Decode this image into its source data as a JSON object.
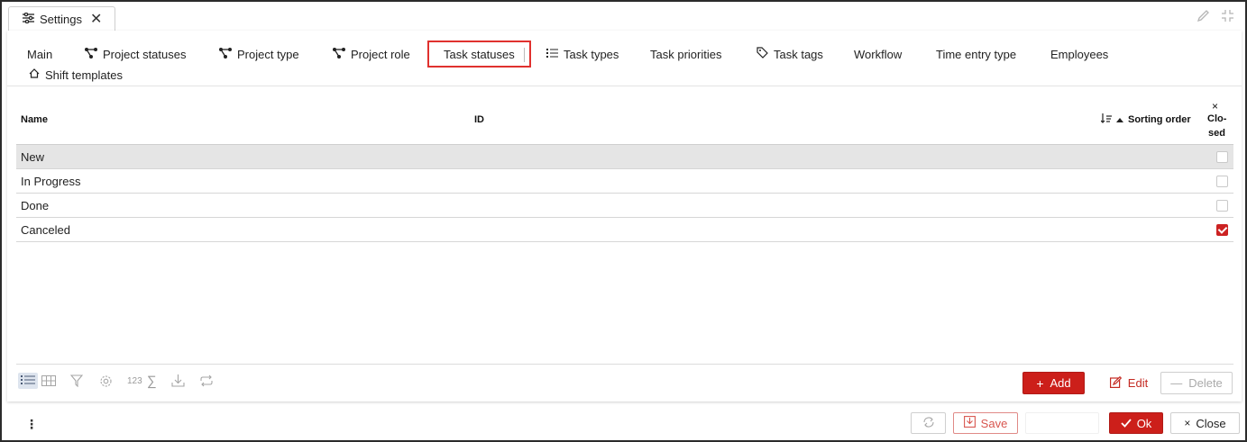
{
  "window": {
    "tab_label": "Settings",
    "tab_icon": "sliders-icon",
    "tab_close": "✕"
  },
  "tabs": [
    {
      "label": "Main",
      "icon": ""
    },
    {
      "label": "Project statuses",
      "icon": "hierarchy-icon"
    },
    {
      "label": "Project type",
      "icon": "hierarchy-icon"
    },
    {
      "label": "Project role",
      "icon": "hierarchy-icon"
    },
    {
      "label": "Task statuses",
      "icon": "",
      "active": true
    },
    {
      "label": "Task types",
      "icon": "list-icon"
    },
    {
      "label": "Task priorities",
      "icon": ""
    },
    {
      "label": "Task tags",
      "icon": "tag-icon"
    },
    {
      "label": "Workflow",
      "icon": ""
    },
    {
      "label": "Time entry type",
      "icon": ""
    },
    {
      "label": "Employees",
      "icon": ""
    },
    {
      "label": "Shift templates",
      "icon": "home-icon"
    }
  ],
  "grid": {
    "columns": {
      "name": "Name",
      "id": "ID",
      "sorting_order": "Sorting order",
      "closed_line1": "Clo-",
      "closed_line2": "sed",
      "closed_x": "×"
    },
    "rows": [
      {
        "name": "New",
        "closed": false,
        "selected": true
      },
      {
        "name": "In Progress",
        "closed": false,
        "selected": false
      },
      {
        "name": "Done",
        "closed": false,
        "selected": false
      },
      {
        "name": "Canceled",
        "closed": true,
        "selected": false
      }
    ]
  },
  "toolbar": {
    "sum_label": "123",
    "add_label": "Add",
    "edit_label": "Edit",
    "delete_label": "Delete"
  },
  "footer": {
    "save_label": "Save",
    "ok_label": "Ok",
    "close_label": "Close"
  },
  "colors": {
    "accent": "#cc1f1a",
    "highlight_border": "#e0312e"
  }
}
